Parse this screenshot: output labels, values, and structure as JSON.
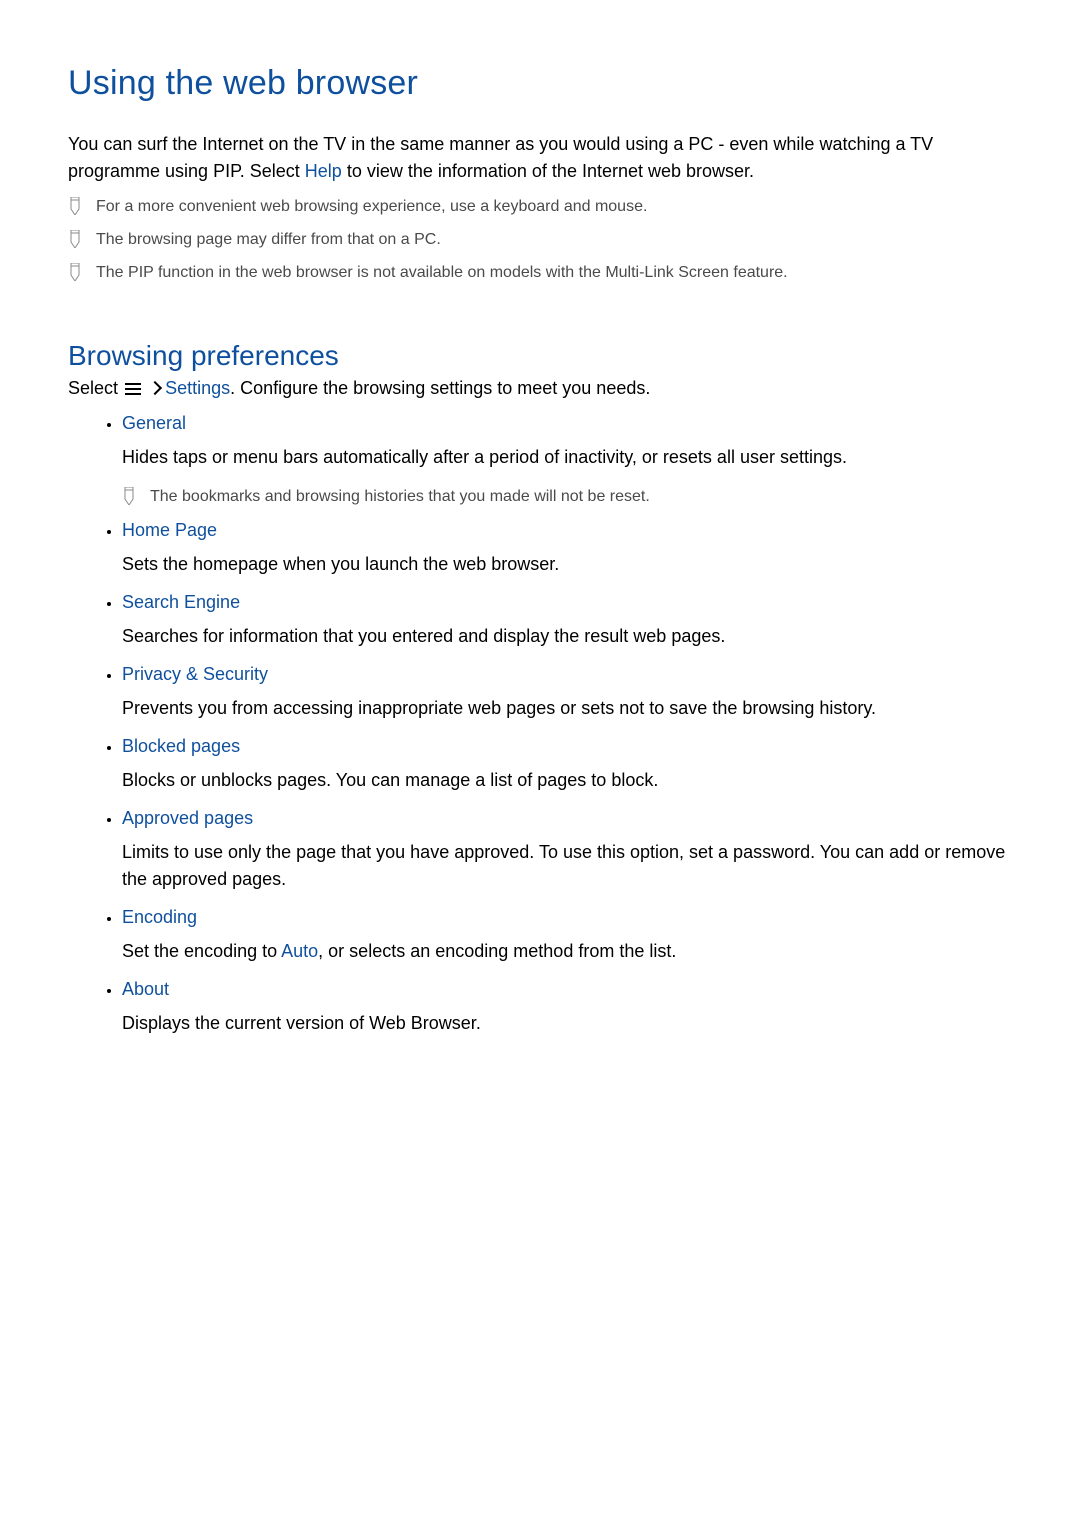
{
  "title": "Using the web browser",
  "intro_part1": "You can surf the Internet on the TV in the same manner as you would using a PC - even while watching a TV programme using PIP. Select ",
  "intro_highlight": "Help",
  "intro_part2": " to view the information of the Internet web browser.",
  "notes": [
    "For a more convenient web browsing experience, use a keyboard and mouse.",
    "The browsing page may differ from that on a PC.",
    "The PIP function in the web browser is not available on models with the Multi-Link Screen feature."
  ],
  "section_title": "Browsing preferences",
  "subintro_part1": "Select ",
  "subintro_settings": "Settings",
  "subintro_part2": ". Configure the browsing settings to meet you needs.",
  "options": [
    {
      "label": "General",
      "desc": "Hides taps or menu bars automatically after a period of inactivity, or resets all user settings.",
      "note": "The bookmarks and browsing histories that you made will not be reset."
    },
    {
      "label": "Home Page",
      "desc": "Sets the homepage when you launch the web browser."
    },
    {
      "label": "Search Engine",
      "desc": "Searches for information that you entered and display the result web pages."
    },
    {
      "label": "Privacy & Security",
      "desc": "Prevents you from accessing inappropriate web pages or sets not to save the browsing history."
    },
    {
      "label": "Blocked pages",
      "desc": "Blocks or unblocks pages. You can manage a list of pages to block."
    },
    {
      "label": "Approved pages",
      "desc": "Limits to use only the page that you have approved. To use this option, set a password. You can add or remove the approved pages."
    },
    {
      "label": "Encoding",
      "desc_pre": "Set the encoding to ",
      "desc_highlight": "Auto",
      "desc_post": ", or selects an encoding method from the list."
    },
    {
      "label": "About",
      "desc": "Displays the current version of Web Browser."
    }
  ]
}
